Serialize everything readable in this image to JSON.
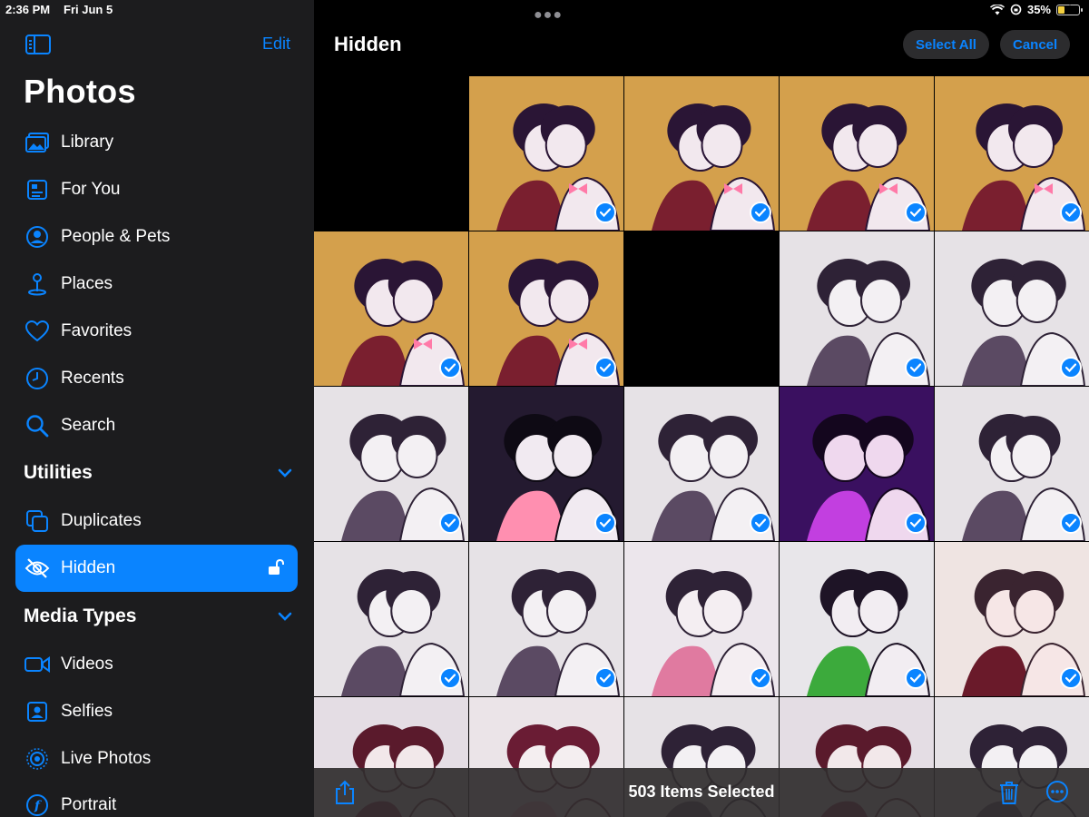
{
  "status_bar": {
    "time": "2:36 PM",
    "date": "Fri Jun 5",
    "battery": "35%",
    "battery_level": 0.35
  },
  "sidebar": {
    "edit_label": "Edit",
    "title": "Photos",
    "items": [
      {
        "label": "Library",
        "icon": "photo-library-icon"
      },
      {
        "label": "For You",
        "icon": "for-you-icon"
      },
      {
        "label": "People & Pets",
        "icon": "person-icon"
      },
      {
        "label": "Places",
        "icon": "map-pin-icon"
      },
      {
        "label": "Favorites",
        "icon": "heart-icon"
      },
      {
        "label": "Recents",
        "icon": "clock-icon"
      },
      {
        "label": "Search",
        "icon": "search-icon"
      }
    ],
    "utilities": {
      "title": "Utilities",
      "items": [
        {
          "label": "Duplicates",
          "icon": "duplicates-icon"
        },
        {
          "label": "Hidden",
          "icon": "eye-slash-icon",
          "selected": true
        }
      ]
    },
    "media_types": {
      "title": "Media Types",
      "items": [
        {
          "label": "Videos",
          "icon": "video-icon"
        },
        {
          "label": "Selfies",
          "icon": "selfie-icon"
        },
        {
          "label": "Live Photos",
          "icon": "live-photo-icon"
        },
        {
          "label": "Portrait",
          "icon": "portrait-icon"
        }
      ]
    }
  },
  "main": {
    "title": "Hidden",
    "select_all_label": "Select All",
    "cancel_label": "Cancel",
    "selection_count": "503 Items Selected",
    "accent_color": "#0a84ff"
  }
}
